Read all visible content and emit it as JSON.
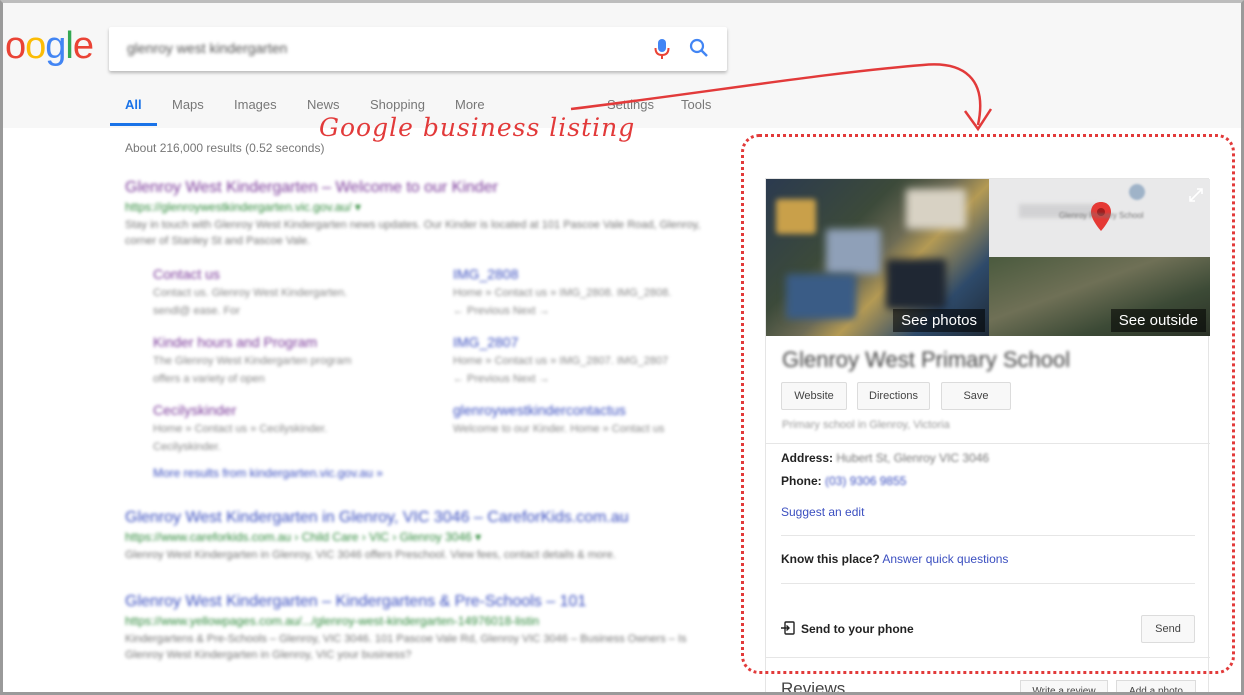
{
  "logo": {
    "letters": [
      "o",
      "o",
      "g",
      "l",
      "e"
    ],
    "colors": [
      "#ea4335",
      "#fbbc05",
      "#4285f4",
      "#34a853",
      "#ea4335"
    ]
  },
  "search": {
    "query": "glenroy west kindergarten"
  },
  "tabs": [
    {
      "label": "All"
    },
    {
      "label": "Maps"
    },
    {
      "label": "Images"
    },
    {
      "label": "News"
    },
    {
      "label": "Shopping"
    },
    {
      "label": "More"
    },
    {
      "label": "Settings"
    },
    {
      "label": "Tools"
    }
  ],
  "annotation": "Google business listing",
  "result_count": "About 216,000 results (0.52 seconds)",
  "results": [
    {
      "title": "Glenroy West Kindergarten – Welcome to our Kinder",
      "url": "https://glenroywestkindergarten.vic.gov.au/ ▾",
      "snippet": "Stay in touch with Glenroy West Kindergarten news updates. Our Kinder is located at 101 Pascoe Vale Road, Glenroy, corner of Stanley St and Pascoe Vale.",
      "sitelinks": [
        {
          "title": "Contact us",
          "snippet": "Contact us. Glenroy West Kindergarten. sendl@ ease. For"
        },
        {
          "title": "IMG_2808",
          "snippet": "Home » Contact us » IMG_2808. IMG_2808. ← Previous Next →"
        },
        {
          "title": "Kinder hours and Program",
          "snippet": "The Glenroy West Kindergarten program offers a variety of open"
        },
        {
          "title": "IMG_2807",
          "snippet": "Home » Contact us » IMG_2807. IMG_2807 ← Previous Next →"
        },
        {
          "title": "Cecilyskinder",
          "snippet": "Home » Contact us » Cecilyskinder. Cecilyskinder."
        },
        {
          "title": "glenroywestkindercontactus",
          "snippet": "Welcome to our Kinder. Home » Contact us"
        }
      ],
      "more": "More results from kindergarten.vic.gov.au »"
    },
    {
      "title": "Glenroy West Kindergarten in Glenroy, VIC 3046 – CareforKids.com.au",
      "url": "https://www.careforkids.com.au › Child Care › VIC › Glenroy 3046 ▾",
      "snippet": "Glenroy West Kindergarten in Glenroy, VIC 3046 offers Preschool. View fees, contact details & more."
    },
    {
      "title": "Glenroy West Kindergarten – Kindergartens & Pre-Schools – 101",
      "url": "https://www.yellowpages.com.au/.../glenroy-west-kindergarten-14976018-listin",
      "snippet": "Kindergartens & Pre-Schools – Glenroy, VIC 3046. 101 Pascoe Vale Rd, Glenroy VIC 3046 – Business Owners – Is Glenroy West Kindergarten in Glenroy, VIC your business?"
    }
  ],
  "panel": {
    "see_photos": "See photos",
    "see_outside": "See outside",
    "map_label": "Glenroy Primary School",
    "name": "Glenroy West Primary School",
    "buttons": {
      "website": "Website",
      "directions": "Directions",
      "save": "Save"
    },
    "category": "Primary school in Glenroy, Victoria",
    "address_label": "Address:",
    "address_value": "Hubert St, Glenroy VIC 3046",
    "phone_label": "Phone:",
    "phone_value": "(03) 9306 9855",
    "suggest_edit": "Suggest an edit",
    "know_label": "Know this place?",
    "know_link": "Answer quick questions",
    "send_label": "Send to your phone",
    "send_button": "Send",
    "reviews_title": "Reviews",
    "write_review": "Write a review",
    "add_photo": "Add a photo"
  },
  "colors": {
    "accent": "#1a73e8",
    "annotation_red": "#e23a3a",
    "visited": "#7b3a9a",
    "url_green": "#2f8a3b",
    "link_blue": "#3b4fc0"
  }
}
